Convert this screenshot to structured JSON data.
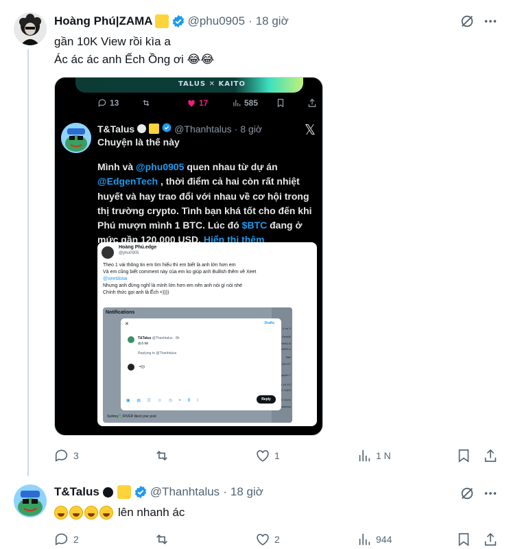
{
  "tweet1": {
    "name": "Hoàng Phú|ZAMA",
    "handle": "@phu0905",
    "time": "18 giờ",
    "lines": [
      "gần 10K View rồi kìa a",
      "Ác ác ác anh Ếch Ồng ơi 😂😂"
    ],
    "actions": {
      "replies": "3",
      "reposts": "",
      "likes": "1",
      "views": "1 N"
    }
  },
  "media": {
    "banner_text": "TALUS ✕ KAITO",
    "stats": {
      "replies": "13",
      "likes": "17",
      "views": "585"
    },
    "quote": {
      "name": "T&Talus",
      "handle": "@Thanhtalus",
      "time": "8 giờ",
      "first_line": "Chuyện là thế này",
      "body_parts": [
        "Mình và ",
        "@phu0905",
        "  quen nhau từ dự án ",
        "@EdgenTech",
        " , thời điểm cả hai còn rất nhiệt huyết và hay trao đổi với nhau về cơ hội trong thị trường crypto. Tình bạn khá tốt cho đến khi Phú mượn mình 1 BTC. Lúc đó ",
        "$BTC",
        " đang ở mức gần 120.000 USD, ",
        "Hiển thị thêm"
      ]
    },
    "inner": {
      "name": "Hoàng Phú.edge",
      "handle": "@phu0905",
      "lines": [
        "Theo 1 vài thông tin em tìm hiểu thì em biết là anh lớn hơn em",
        "Và em cũng biết comment này của em ko giúp anh Bullish thêm về Xeet",
        "@xeetdotai",
        "Nhưng anh đừng nghĩ là mình lớn hơn em nên anh nói gì nói nhé",
        "Chính thức gọi anh là Ếch =))))"
      ],
      "notifications_label": "Notifications",
      "drafts": "Drafts",
      "modal_name": "T&Talus",
      "modal_handle": "@Thanhtalus · 8h",
      "modal_line": "dị ô hê",
      "replying_to": "Replying to @Thanhtalus",
      "reply_text": "=)))",
      "reply_button": "Reply",
      "liked_text": "Sydney🦎RIVER liked your post",
      "strip": [
        "e on X",
        "GeoMir",
        "ENING B",
        "SADING A",
        "Belt",
        "E CRYPT",
        "Nguyên T",
        "N 1K FO",
        "ND TUES",
        "Tarí Chính",
        "Leaderboa"
      ]
    }
  },
  "tweet2": {
    "name": "T&Talus",
    "handle": "@Thanhtalus",
    "time": "18 giờ",
    "text": "lên nhanh ác",
    "actions": {
      "replies": "2",
      "reposts": "",
      "likes": "2",
      "views": "944"
    }
  }
}
